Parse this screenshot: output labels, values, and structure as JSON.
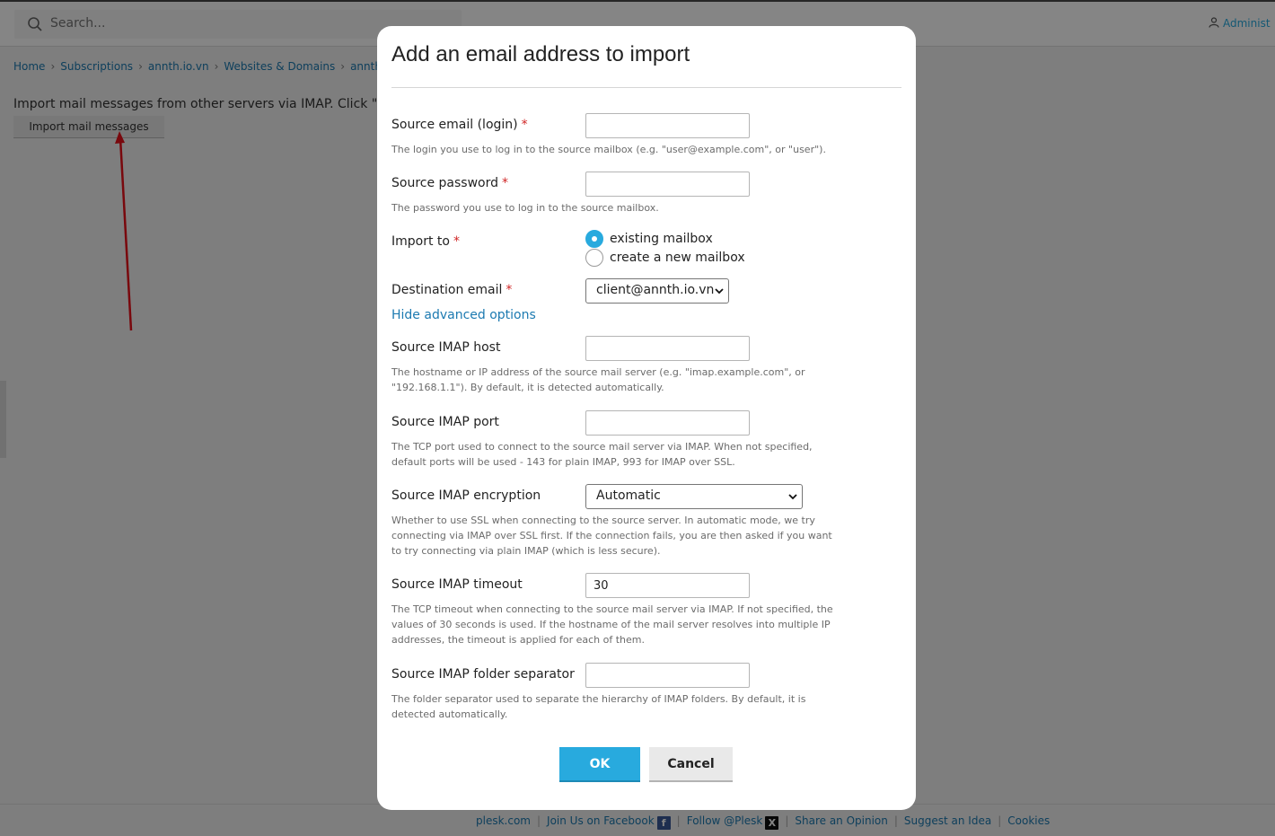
{
  "search": {
    "placeholder": "Search..."
  },
  "user": {
    "label": "Administ"
  },
  "breadcrumb": [
    "Home",
    "Subscriptions",
    "annth.io.vn",
    "Websites & Domains",
    "annth."
  ],
  "page": {
    "intro": "Import mail messages from other servers via IMAP. Click \"Impo",
    "import_button": "Import mail messages"
  },
  "modal": {
    "title": "Add an email address to import",
    "source_email": {
      "label": "Source email (login)",
      "required": "*",
      "value": "",
      "hint": "The login you use to log in to the source mailbox (e.g. \"user@example.com\", or \"user\")."
    },
    "source_password": {
      "label": "Source password",
      "required": "*",
      "value": "",
      "hint": "The password you use to log in to the source mailbox."
    },
    "import_to": {
      "label": "Import to",
      "required": "*",
      "options": [
        "existing mailbox",
        "create a new mailbox"
      ],
      "selected": "existing mailbox"
    },
    "destination_email": {
      "label": "Destination email",
      "required": "*",
      "value": "client@annth.io.vn"
    },
    "advanced_link": "Hide advanced options",
    "imap_host": {
      "label": "Source IMAP host",
      "value": "",
      "hint": "The hostname or IP address of the source mail server (e.g. \"imap.example.com\", or \"192.168.1.1\"). By default, it is detected automatically."
    },
    "imap_port": {
      "label": "Source IMAP port",
      "value": "",
      "hint": "The TCP port used to connect to the source mail server via IMAP. When not specified, default ports will be used - 143 for plain IMAP, 993 for IMAP over SSL."
    },
    "imap_encryption": {
      "label": "Source IMAP encryption",
      "value": "Automatic",
      "hint": "Whether to use SSL when connecting to the source server. In automatic mode, we try connecting via IMAP over SSL first. If the connection fails, you are then asked if you want to try connecting via plain IMAP (which is less secure)."
    },
    "imap_timeout": {
      "label": "Source IMAP timeout",
      "value": "30",
      "hint": "The TCP timeout when connecting to the source mail server via IMAP. If not specified, the values of 30 seconds is used. If the hostname of the mail server resolves into multiple IP addresses, the timeout is applied for each of them."
    },
    "imap_separator": {
      "label": "Source IMAP folder separator",
      "value": "",
      "hint": "The folder separator used to separate the hierarchy of IMAP folders. By default, it is detected automatically."
    },
    "ok_label": "OK",
    "cancel_label": "Cancel"
  },
  "footer": {
    "links": [
      "plesk.com",
      "Join Us on Facebook",
      "Follow @Plesk",
      "Share an Opinion",
      "Suggest an Idea",
      "Cookies"
    ],
    "facebook_icon": "f",
    "x_icon": "X"
  },
  "colors": {
    "accent": "#28aade",
    "link": "#1c7ab1",
    "required": "#d02525",
    "annotation_arrow": "#e8111a"
  },
  "icons": [
    "search-icon",
    "user-icon",
    "facebook-icon",
    "x-icon",
    "chevron-down-icon",
    "annotation-arrow"
  ]
}
